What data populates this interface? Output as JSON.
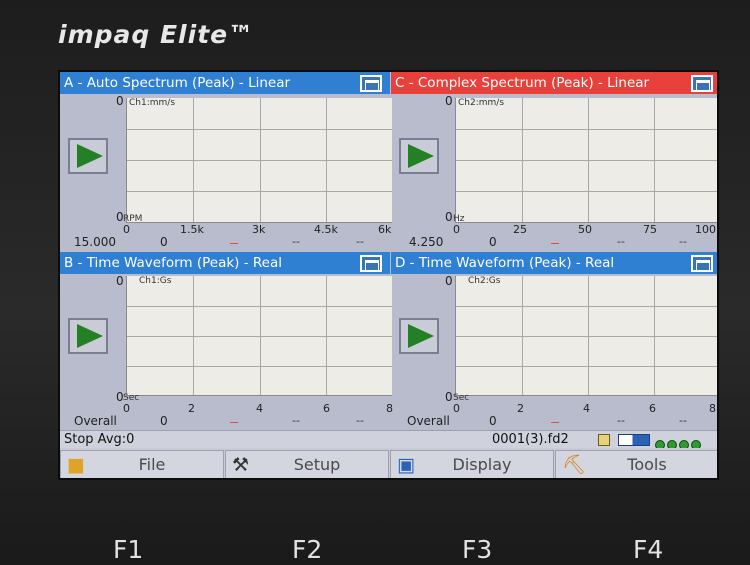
{
  "device": {
    "brand": "impaq Elite™",
    "fkeys": [
      "F1",
      "F2",
      "F3",
      "F4"
    ]
  },
  "panels": {
    "a": {
      "title": "A - Auto Spectrum (Peak) - Linear",
      "title_color": "#2f7fd3",
      "channel": "Ch1:mm/s",
      "y_zero_top": "0",
      "y_zero_bottom": "0",
      "x_unit": "RPM",
      "x_ticks": [
        "0",
        "1.5k",
        "3k",
        "4.5k",
        "6k"
      ],
      "cursor_value": "15.000",
      "cursor_zero": "0",
      "dashes": [
        "--",
        "--"
      ]
    },
    "c": {
      "title": "C - Complex Spectrum (Peak) - Linear",
      "title_color": "#e8413b",
      "channel": "Ch2:mm/s",
      "y_zero_top": "0",
      "y_zero_bottom": "0",
      "x_unit": "Hz",
      "x_ticks": [
        "0",
        "25",
        "50",
        "75",
        "100"
      ],
      "cursor_value": "4.250",
      "cursor_zero": "0",
      "dashes": [
        "--",
        "--"
      ]
    },
    "b": {
      "title": "B - Time Waveform (Peak) - Real",
      "title_color": "#2f7fd3",
      "channel": "Ch1:Gs",
      "y_zero_top": "0",
      "y_zero_bottom": "0",
      "x_unit": "Sec",
      "x_ticks": [
        "0",
        "2",
        "4",
        "6",
        "8"
      ],
      "cursor_value": "Overall",
      "cursor_zero": "0",
      "dashes": [
        "--",
        "--"
      ]
    },
    "d": {
      "title": "D - Time Waveform (Peak) - Real",
      "title_color": "#2f7fd3",
      "channel": "Ch2:Gs",
      "y_zero_top": "0",
      "y_zero_bottom": "0",
      "x_unit": "Sec",
      "x_ticks": [
        "0",
        "2",
        "4",
        "6",
        "8"
      ],
      "cursor_value": "Overall",
      "cursor_zero": "0",
      "dashes": [
        "--",
        "--"
      ]
    }
  },
  "status": {
    "text": "Stop  Avg:0",
    "file": "0001(3).fd2"
  },
  "fbar": {
    "file": "File",
    "setup": "Setup",
    "display": "Display",
    "tools": "Tools"
  },
  "icons": {
    "play": "play-triangle-icon",
    "window": "window-restore-icon",
    "folder": "folder-icon",
    "tools": "wrench-screwdriver-icon",
    "display": "document-display-icon",
    "setup": "setup-tools-icon"
  },
  "colors": {
    "play_green": "#238024",
    "plot_bg": "#edece6",
    "panel_bg": "#b8bccd"
  }
}
